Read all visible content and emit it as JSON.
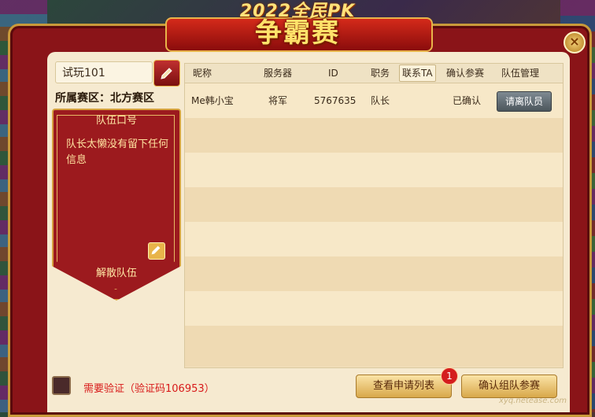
{
  "banner": {
    "top": "2022全民PK",
    "main": "争霸赛"
  },
  "team": {
    "name": "试玩101",
    "region_label": "所属赛区：北方赛区",
    "slogan_title": "队伍口号",
    "slogan_text": "队长太懒没有留下任何信息",
    "disband_label": "解散队伍"
  },
  "table": {
    "headers": [
      "昵称",
      "服务器",
      "ID",
      "职务",
      "联系TA",
      "确认参赛",
      "队伍管理"
    ],
    "rows": [
      {
        "nickname": "Me韩小宝",
        "server": "将军",
        "id": "5767635",
        "role": "队长",
        "confirm": "已确认",
        "action": "请离队员"
      }
    ]
  },
  "footer": {
    "verify_text": "需要验证（验证码106953）",
    "view_apps_label": "查看申请列表",
    "apps_badge": "1",
    "confirm_label": "确认组队参赛"
  },
  "watermark": "xyq.netease.com",
  "close_icon": "close-icon",
  "edit_icon": "pencil-icon"
}
